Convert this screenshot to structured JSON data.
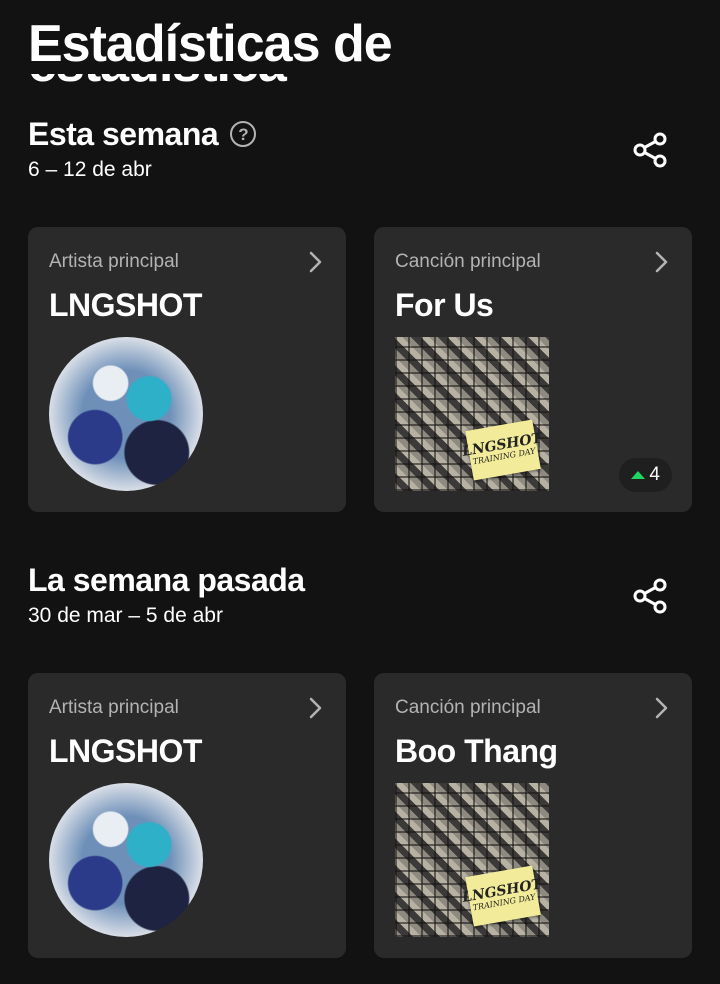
{
  "page": {
    "title": "Estadísticas de"
  },
  "sections": [
    {
      "title": "Esta semana",
      "date_range": "6 – 12 de abr",
      "artist_card": {
        "label": "Artista principal",
        "name": "LNGSHOT"
      },
      "song_card": {
        "label": "Canción principal",
        "name": "For Us",
        "cover_note": {
          "line1": "LNGSHOT",
          "line2": "TRAINING DAY"
        },
        "rank_change": "4",
        "rank_change_color": "#1ed760"
      }
    },
    {
      "title": "La semana pasada",
      "date_range": "30 de mar – 5 de abr",
      "artist_card": {
        "label": "Artista principal",
        "name": "LNGSHOT"
      },
      "song_card": {
        "label": "Canción principal",
        "name": "Boo Thang",
        "cover_note": {
          "line1": "LNGSHOT",
          "line2": "TRAINING DAY"
        }
      }
    }
  ],
  "colors": {
    "background": "#121212",
    "card": "#2a2a2a",
    "muted_text": "#b3b3b3",
    "accent_green": "#1ed760"
  },
  "icons": {
    "help": "question-circle-icon",
    "share": "share-icon",
    "chevron": "chevron-right-icon",
    "rank_up": "triangle-up-icon"
  }
}
